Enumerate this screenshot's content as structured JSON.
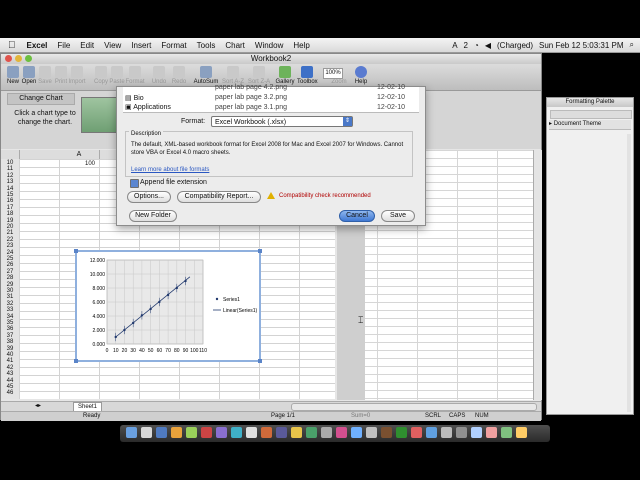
{
  "menubar": {
    "apple": "",
    "items": [
      "Excel",
      "File",
      "Edit",
      "View",
      "Insert",
      "Format",
      "Tools",
      "Chart",
      "Window",
      "Help"
    ],
    "status_icons": [
      "A",
      "2"
    ],
    "battery": "(Charged)",
    "clock": "Sun Feb 12  5:03:31 PM"
  },
  "window": {
    "title": "Workbook2"
  },
  "toolbar": {
    "buttons": [
      "New",
      "Open",
      "Save",
      "Print",
      "Import",
      "Copy",
      "Paste",
      "Format",
      "Undo",
      "Redo",
      "AutoSum",
      "Sort A-Z",
      "Sort Z-A",
      "Gallery",
      "Toolbox",
      "Zoom",
      "Help"
    ],
    "zoom_value": "100%"
  },
  "ribbon": {
    "change_chart": "Change Chart",
    "click_text": "Click a chart type to change the chart."
  },
  "grid": {
    "columns": [
      "A",
      "B"
    ],
    "rows": [
      "10",
      "11",
      "12",
      "13",
      "14",
      "15",
      "16",
      "17",
      "18",
      "19",
      "20",
      "21",
      "22",
      "23",
      "24",
      "25",
      "26",
      "27",
      "28",
      "29",
      "30",
      "31",
      "32",
      "33",
      "34",
      "35",
      "36",
      "37",
      "38",
      "39",
      "40",
      "41",
      "42",
      "43",
      "44",
      "45",
      "46"
    ],
    "cell_value": "100"
  },
  "chart_data": {
    "type": "scatter",
    "x_ticks": [
      "0",
      "10",
      "20",
      "30",
      "40",
      "50",
      "60",
      "70",
      "80",
      "90",
      "100",
      "110"
    ],
    "y_ticks": [
      "0.000",
      "2.000",
      "4.000",
      "6.000",
      "8.000",
      "10.000",
      "12.000"
    ],
    "xlim": [
      0,
      110
    ],
    "ylim": [
      0,
      12
    ],
    "series": [
      {
        "name": "Series1",
        "x": [
          10,
          20,
          30,
          40,
          50,
          60,
          70,
          80,
          90
        ],
        "y": [
          1.0,
          2.0,
          3.0,
          4.1,
          5.0,
          6.0,
          7.0,
          8.0,
          9.0
        ]
      }
    ],
    "trendline": {
      "name": "Linear(Series1)",
      "from": [
        10,
        1.0
      ],
      "to": [
        95,
        9.6
      ]
    },
    "legend": [
      "Series1",
      "Linear(Series1)"
    ],
    "legend_position": "right",
    "grid": true,
    "error_bars": true
  },
  "dialog": {
    "sidebar_items": [
      "Bio",
      "Applications"
    ],
    "files": [
      {
        "name": "paper lab page 4.2.png",
        "date": "12-02-10"
      },
      {
        "name": "paper lab page 3.2.png",
        "date": "12-02-10"
      },
      {
        "name": "paper lab page 3.1.png",
        "date": "12-02-10"
      }
    ],
    "format_label": "Format:",
    "format_value": "Excel Workbook (.xlsx)",
    "description_title": "Description",
    "description_text": "The default, XML-based workbook format for Excel 2008 for Mac and Excel 2007 for Windows. Cannot store VBA or Excel 4.0 macro sheets.",
    "learn_more": "Learn more about file formats",
    "append_label": "Append file extension",
    "options_button": "Options...",
    "compat_button": "Compatibility Report...",
    "compat_warning": "Compatibility check recommended",
    "new_folder_button": "New Folder",
    "cancel_button": "Cancel",
    "save_button": "Save"
  },
  "palette": {
    "title": "Formatting Palette",
    "section": "Document Theme"
  },
  "sheet_tabs": [
    "Sheet1"
  ],
  "status": {
    "ready": "Ready",
    "page": "Page 1/1",
    "sum": "Sum=0",
    "scrl": "SCRL",
    "caps": "CAPS",
    "num": "NUM"
  },
  "colors": {
    "chart_border": "#8fb0de",
    "cancel_button": "#4f86d8",
    "warning_text": "#b00000",
    "link": "#2a57c2"
  }
}
